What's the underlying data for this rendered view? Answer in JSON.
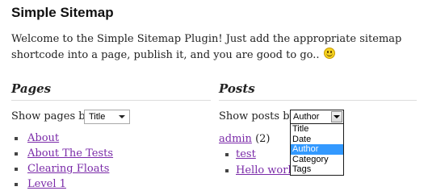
{
  "title": "Simple Sitemap",
  "intro": "Welcome to the Simple Sitemap Plugin! Just add the appropriate sitemap shortcode into a page, publish it, and you are good to go..",
  "pages": {
    "heading": "Pages",
    "show_label": "Show pages by:",
    "select_value": "Title",
    "items": [
      "About",
      "About The Tests",
      "Clearing Floats",
      "Level 1"
    ]
  },
  "posts": {
    "heading": "Posts",
    "show_label": "Show posts by:",
    "select_value": "Author",
    "options": [
      "Title",
      "Date",
      "Author",
      "Category",
      "Tags"
    ],
    "selected_option": "Author",
    "author_name": "admin",
    "author_count": "(2)",
    "items": [
      "test",
      "Hello world!"
    ]
  },
  "colors": {
    "link": "#7a2aa8",
    "highlight": "#3399ff"
  },
  "icons": {
    "smiley": "smiley-emoticon-icon",
    "select_arrow": "chevron-down-icon"
  }
}
